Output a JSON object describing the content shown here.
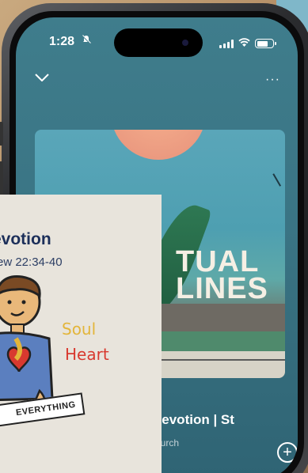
{
  "status_bar": {
    "time": "1:28"
  },
  "header": {
    "more_label": "···"
  },
  "artwork": {
    "title_line1": "TUAL",
    "title_line2": "LINES"
  },
  "now_playing": {
    "title": "Devotion | St",
    "artist": "hurch",
    "add_label": "+"
  },
  "overlay_card": {
    "title": "evotion",
    "subtitle": "ew 22:34-40",
    "word1": "Soul",
    "word2": "Heart",
    "banner_text": "EVERYTHING"
  },
  "colors": {
    "screen_teal": "#3f7d8c",
    "card_bg": "#e8e4dc",
    "heart_red": "#d8392f",
    "soul_yellow": "#e3b53a"
  }
}
